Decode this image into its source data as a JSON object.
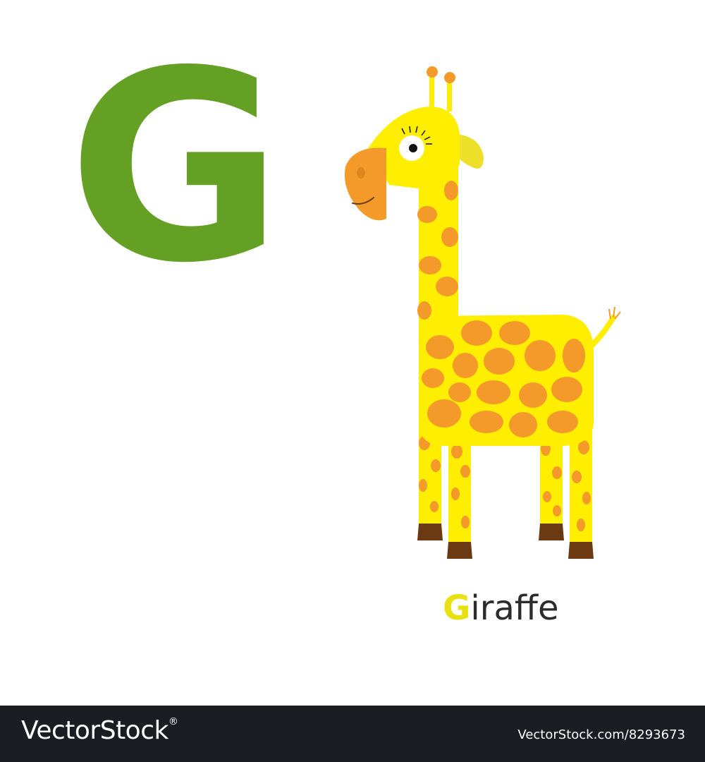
{
  "card": {
    "letter": "G",
    "caption_initial": "G",
    "caption_rest": "iraffe",
    "colors": {
      "letter": "#64a024",
      "caption_initial": "#e8e10f",
      "giraffe_body": "#ffee00",
      "giraffe_spots": "#f49a2a",
      "hooves": "#6b3a12"
    },
    "illustration": "giraffe-illustration"
  },
  "footer": {
    "logo_text": "VectorStock",
    "logo_mark": "®",
    "url": "VectorStock.com/8293673"
  }
}
